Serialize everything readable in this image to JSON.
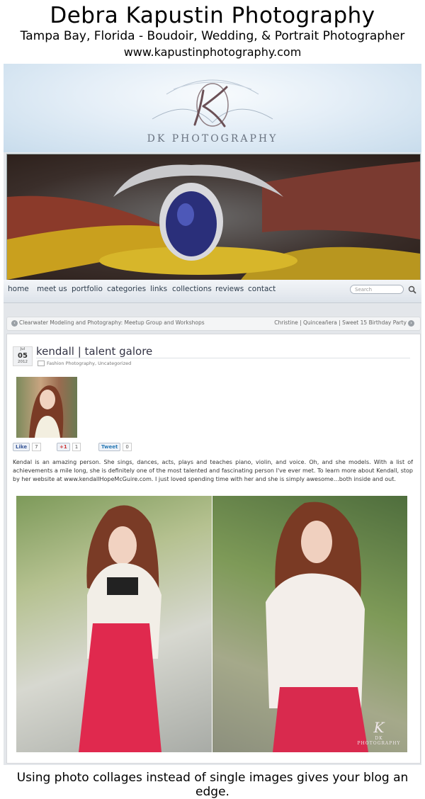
{
  "banner": {
    "title": "Debra Kapustin Photography",
    "subtitle": "Tampa Bay, Florida - Boudoir, Wedding, & Portrait Photographer",
    "url": "www.kapustinphotography.com"
  },
  "header": {
    "brand": "DK PHOTOGRAPHY"
  },
  "nav": {
    "items": [
      "home",
      "meet us",
      "portfolio",
      "categories",
      "links",
      "collections",
      "reviews",
      "contact"
    ],
    "search_placeholder": "Search"
  },
  "postnav": {
    "prev": "Clearwater Modeling and Photography: Meetup Group and Workshops",
    "next": "Christine | Quinceañera | Sweet 15 Birthday Party"
  },
  "post": {
    "date_month": "Jul",
    "date_day": "05",
    "date_year": "2012",
    "title": "kendall | talent galore",
    "categories": "Fashion Photography, Uncategorized",
    "social": {
      "like_label": "Like",
      "like_count": "7",
      "plus_label": "+1",
      "plus_count": "1",
      "tweet_label": "Tweet",
      "tweet_count": "0"
    },
    "body": "Kendal is an amazing person. She sings, dances, acts, plays and teaches piano, violin, and voice. Oh, and she models. With a list of achievements a mile long, she is definitely one of the most talented and fascinating person I've ever met. To learn more about Kendall, stop by her website at www.kendallHopeMcGuire.com. I just loved spending time with her and she is simply awesome…both inside and out.",
    "watermark": "DK PHOTOGRAPHY"
  },
  "caption": "Using photo collages instead of single images gives your blog an edge."
}
